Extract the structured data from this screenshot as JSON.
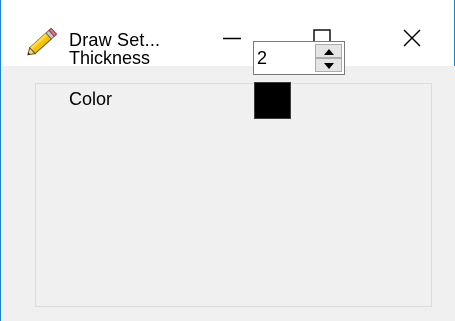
{
  "window": {
    "title": "Draw Set...",
    "icon": "pencil-icon"
  },
  "caption_buttons": {
    "minimize_icon": "minimize-icon",
    "maximize_icon": "maximize-icon",
    "close_icon": "close-icon"
  },
  "form": {
    "thickness_label": "Thickness",
    "thickness_value": "2",
    "color_label": "Color",
    "color_value": "#000000"
  },
  "colors": {
    "window_border": "#1883d7",
    "client_background": "#f0f0f0",
    "swatch": "#000000"
  }
}
